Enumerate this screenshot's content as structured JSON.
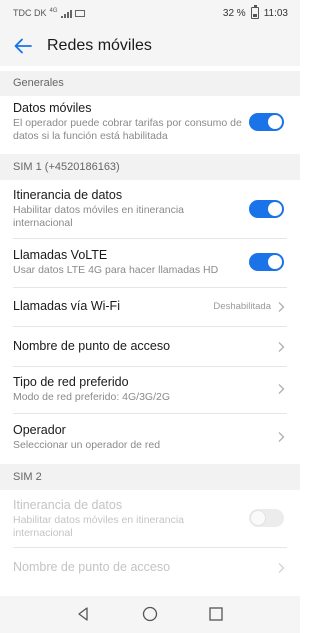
{
  "status_bar": {
    "carrier": "TDC DK",
    "network": "4G",
    "battery": "32 %",
    "time": "11:03"
  },
  "header": {
    "title": "Redes móviles",
    "back_icon": "arrow-left-icon"
  },
  "colors": {
    "accent": "#1a73e8",
    "section_bg": "#f2f2f2"
  },
  "sections": {
    "general": "Generales",
    "sim1": "SIM 1 (+4520186163)",
    "sim2": "SIM 2"
  },
  "items": {
    "datos_moviles": {
      "title": "Datos móviles",
      "subtitle": "El operador puede cobrar tarifas por consumo de datos si la función está habilitada",
      "toggle": true
    },
    "sim1_itinerancia": {
      "title": "Itinerancia de datos",
      "subtitle": "Habilitar datos móviles en itinerancia internacional",
      "toggle": true
    },
    "volte": {
      "title": "Llamadas VoLTE",
      "subtitle": "Usar datos LTE 4G para hacer llamadas HD",
      "toggle": true
    },
    "wifi_calls": {
      "title": "Llamadas vía Wi-Fi",
      "value": "Deshabilitada"
    },
    "apn": {
      "title": "Nombre de punto de acceso"
    },
    "red_preferida": {
      "title": "Tipo de red preferido",
      "subtitle": "Modo de red preferido: 4G/3G/2G"
    },
    "operador": {
      "title": "Operador",
      "subtitle": "Seleccionar un operador de red"
    },
    "sim2_itinerancia": {
      "title": "Itinerancia de datos",
      "subtitle": "Habilitar datos móviles en itinerancia internacional",
      "toggle": false
    },
    "sim2_apn": {
      "title": "Nombre de punto de acceso"
    }
  },
  "nav": {
    "back": "triangle-back-icon",
    "home": "circle-home-icon",
    "recents": "square-recents-icon"
  }
}
